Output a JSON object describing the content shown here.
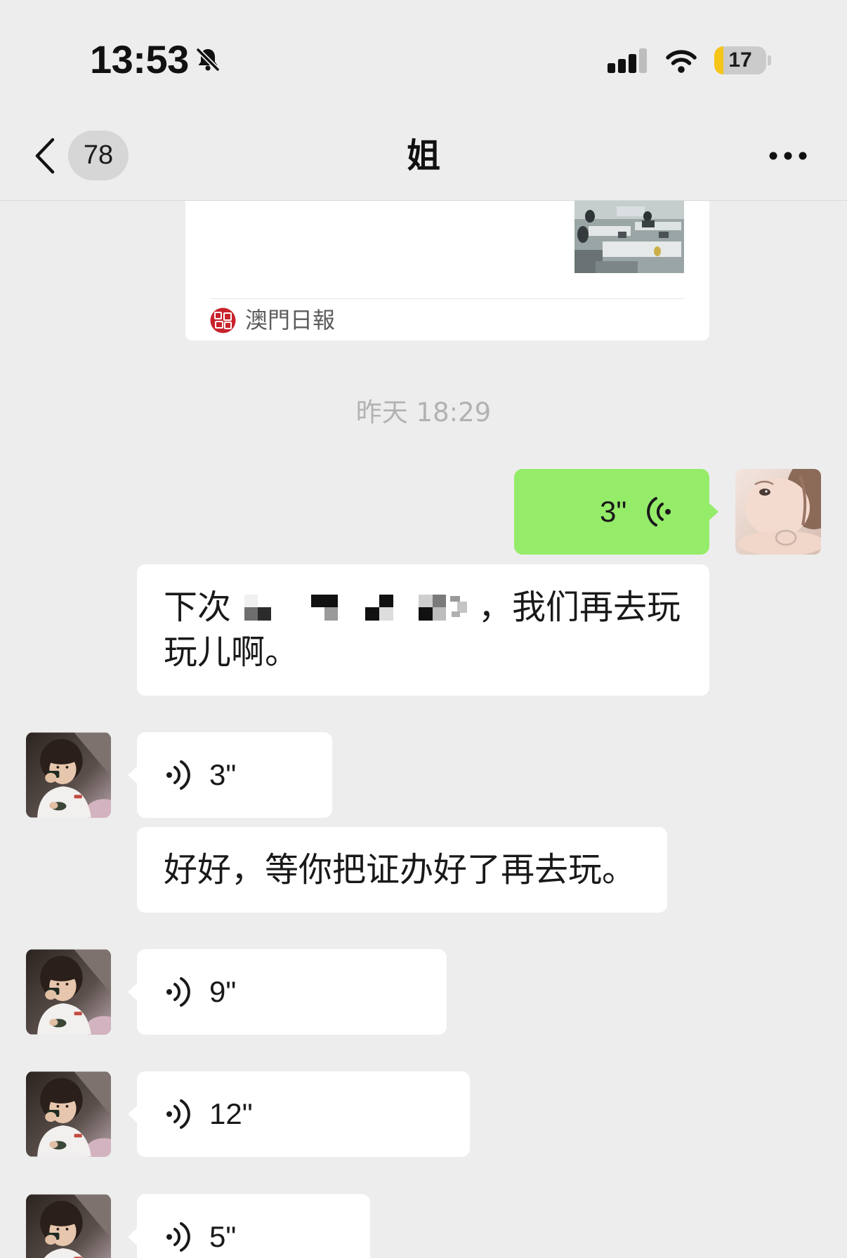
{
  "status_bar": {
    "time": "13:53",
    "battery_level": "17",
    "icons": {
      "silent": "bell-slash-icon",
      "signal": "cellular-signal-icon",
      "wifi": "wifi-icon",
      "battery": "battery-icon"
    }
  },
  "nav_bar": {
    "back_icon": "chevron-left-icon",
    "unread_count": "78",
    "title": "姐",
    "more_icon": "more-dots-icon"
  },
  "link_card": {
    "source_name": "澳門日報",
    "source_icon": "news-logo-icon"
  },
  "timestamp": "昨天 18:29",
  "messages": {
    "outgoing_voice_1": {
      "duration": "3\"",
      "icon": "voice-wave-icon"
    },
    "incoming_text_1": {
      "line1_start": "下次",
      "line1_end": "，我们再去玩",
      "line2": "玩儿啊。"
    },
    "incoming_voice_1": {
      "duration": "3\"",
      "icon": "voice-wave-icon"
    },
    "incoming_text_2": {
      "text": "好好，等你把证办好了再去玩。"
    },
    "incoming_voice_2": {
      "duration": "9\"",
      "icon": "voice-wave-icon"
    },
    "incoming_voice_3": {
      "duration": "12\"",
      "icon": "voice-wave-icon"
    },
    "incoming_voice_4": {
      "duration": "5\"",
      "icon": "voice-wave-icon"
    }
  },
  "colors": {
    "background": "#ededed",
    "my_bubble": "#95ec69",
    "other_bubble": "#ffffff",
    "timestamp": "#b2b2b2",
    "battery_low_power": "#f5c518"
  }
}
